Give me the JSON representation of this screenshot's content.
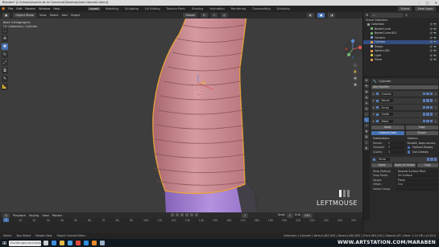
{
  "window": {
    "title": "Blender* [C:\\Users\\Usuario de la Comercial\\Desktop\\Asia tutorial2.blend]",
    "controls": [
      "–",
      "▢",
      "✕"
    ]
  },
  "menubar": {
    "menus": [
      "File",
      "Edit",
      "Render",
      "Window",
      "Help"
    ],
    "workspaces": [
      "Layout",
      "Modeling",
      "Sculpting",
      "UV Editing",
      "Texture Paint",
      "Shading",
      "Animation",
      "Rendering",
      "Compositing",
      "Scripting"
    ],
    "active_workspace": "Layout",
    "scene_label": "Scene",
    "view_layer_label": "View Layer"
  },
  "viewport": {
    "mode": "Object Mode",
    "menus": [
      "View",
      "Select",
      "Add",
      "Object"
    ],
    "global": "Global",
    "info_line1": "Back Orthographic",
    "info_line2": "(1) Collection | Cylinder",
    "last_input": "LEFTMOUSE"
  },
  "outliner": {
    "header": "Scene Collection",
    "items": [
      {
        "label": "Collection",
        "color": "#9a9a9a",
        "selected": false
      },
      {
        "label": "BezierCurve",
        "color": "#6fb26f",
        "selected": false
      },
      {
        "label": "BezierCurve.001",
        "color": "#6fb26f",
        "selected": false
      },
      {
        "label": "Camera",
        "color": "#7f9fd8",
        "selected": false
      },
      {
        "label": "Cylinder",
        "color": "#e39a4a",
        "selected": true
      },
      {
        "label": "Empty",
        "color": "#c0c0c0",
        "selected": false
      },
      {
        "label": "Sphere.001",
        "color": "#e39a4a",
        "selected": false
      },
      {
        "label": "Light",
        "color": "#d8c14f",
        "selected": false
      },
      {
        "label": "Plane",
        "color": "#e39a4a",
        "selected": false
      }
    ]
  },
  "properties": {
    "object_name": "Cylinder",
    "add_modifier": "Add Modifier",
    "modifiers": [
      "Subdiv",
      "Bevel",
      "Array",
      "Solidi",
      "Weld"
    ],
    "apply": "Apply",
    "copy": "Copy",
    "tab_catmull": "Catmull-Clark",
    "tab_simple": "Simple",
    "subdiv_heading": "Subdivisions:",
    "subdiv_rows": [
      {
        "label": "Render",
        "value": "2"
      },
      {
        "label": "Viewport",
        "value": "2"
      },
      {
        "label": "Quality",
        "value": "3"
      }
    ],
    "options_heading": "Options:",
    "options_rows": [
      {
        "label": "Smooth, keep corners"
      },
      {
        "label": "Optimal Display"
      },
      {
        "label": "Use Creases"
      }
    ],
    "shrinkwrap_label": "Shrin",
    "apply_as_shape": "Apply as Shape",
    "wrap_method_label": "Wrap Method:",
    "snap_mode_label": "Snap Mode:",
    "target_label": "Target:",
    "offset_label": "Offset:",
    "vertex_group_label": "Vertex Group:",
    "offset_value": "0 m",
    "nearest_value": "Nearest Surface Point",
    "on_surface_value": "On Surface",
    "target_value": "Plane"
  },
  "timeline": {
    "playback": "Playback",
    "keying": "Keying",
    "view": "View",
    "marker": "Marker",
    "current_frame": "1",
    "start_label": "Start",
    "start": "1",
    "end_label": "End",
    "end": "250",
    "ticks": [
      "0",
      "10",
      "20",
      "30",
      "40",
      "50",
      "60",
      "70",
      "80",
      "90",
      "100",
      "110",
      "120",
      "130",
      "140",
      "150",
      "160",
      "170",
      "180",
      "190",
      "200",
      "210",
      "220",
      "230",
      "240",
      "250"
    ]
  },
  "statusbar": {
    "items": [
      "Select",
      "Box Select",
      "Rotate View",
      "Object Context Menu"
    ],
    "stats": "Collection | Cylinder | Verts:2,487,053 | Faces:2,481,600 | Tris:4,963,200 | Objects:1/9 | Mem: 1.14 GB | v2.83.0"
  },
  "taskbar": {
    "search": "Escribe aquí para buscar",
    "icons": [
      {
        "name": "task-view-icon",
        "color": "#cfcfcf"
      },
      {
        "name": "edge-icon",
        "color": "#3c8fe0"
      },
      {
        "name": "explorer-icon",
        "color": "#e5b94a"
      },
      {
        "name": "store-icon",
        "color": "#4aa3e5"
      },
      {
        "name": "chrome-icon",
        "color": "#e24b3b"
      },
      {
        "name": "photoshop-icon",
        "color": "#2f8fe0"
      },
      {
        "name": "blender-icon",
        "color": "#e98a2a"
      },
      {
        "name": "steam-icon",
        "color": "#9cb3c9"
      }
    ],
    "watermark": "WWW.ARTSTATION.COM/MARABEN"
  },
  "colors": {
    "accent": "#4772b3",
    "mesh_skin": "#c9868e",
    "mesh_base": "#9a7ac9",
    "selection_outline": "#e8a23b"
  }
}
